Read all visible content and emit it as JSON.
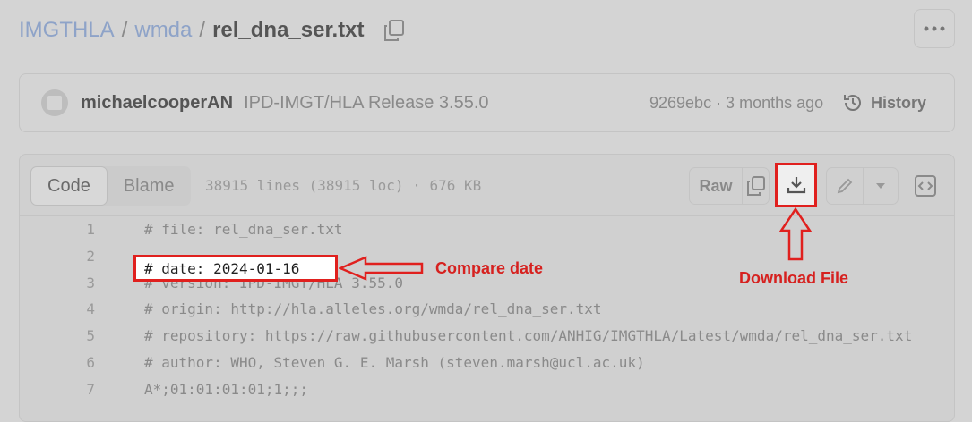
{
  "breadcrumb": {
    "repo": "IMGTHLA",
    "folder": "wmda",
    "file": "rel_dna_ser.txt",
    "separator": "/"
  },
  "commit": {
    "author": "michaelcooperAN",
    "message": "IPD-IMGT/HLA Release 3.55.0",
    "meta": "9269ebc · 3 months ago",
    "history_label": "History"
  },
  "viewer": {
    "tabs": [
      "Code",
      "Blame"
    ],
    "active_tab": "Code",
    "file_info": "38915 lines (38915 loc) · 676 KB",
    "raw_label": "Raw"
  },
  "code_lines": [
    {
      "n": "1",
      "text": "# file: rel_dna_ser.txt"
    },
    {
      "n": "2",
      "text": "# date: 2024-01-16"
    },
    {
      "n": "3",
      "text": "# version: IPD-IMGT/HLA 3.55.0"
    },
    {
      "n": "4",
      "text": "# origin: http://hla.alleles.org/wmda/rel_dna_ser.txt"
    },
    {
      "n": "5",
      "text": "# repository: https://raw.githubusercontent.com/ANHIG/IMGTHLA/Latest/wmda/rel_dna_ser.txt"
    },
    {
      "n": "6",
      "text": "# author: WHO, Steven G. E. Marsh (steven.marsh@ucl.ac.uk)"
    },
    {
      "n": "7",
      "text": "A*;01:01:01:01;1;;;"
    }
  ],
  "annotations": {
    "compare_date": "Compare date",
    "download_file": "Download File",
    "color": "#e0201e"
  },
  "icons": {
    "copy_path": "copy-icon",
    "more": "kebab-horizontal-icon",
    "history": "history-icon",
    "copy_raw": "copy-icon",
    "download": "download-icon",
    "edit": "pencil-icon",
    "dropdown": "triangle-down-icon",
    "symbols": "code-square-icon"
  }
}
